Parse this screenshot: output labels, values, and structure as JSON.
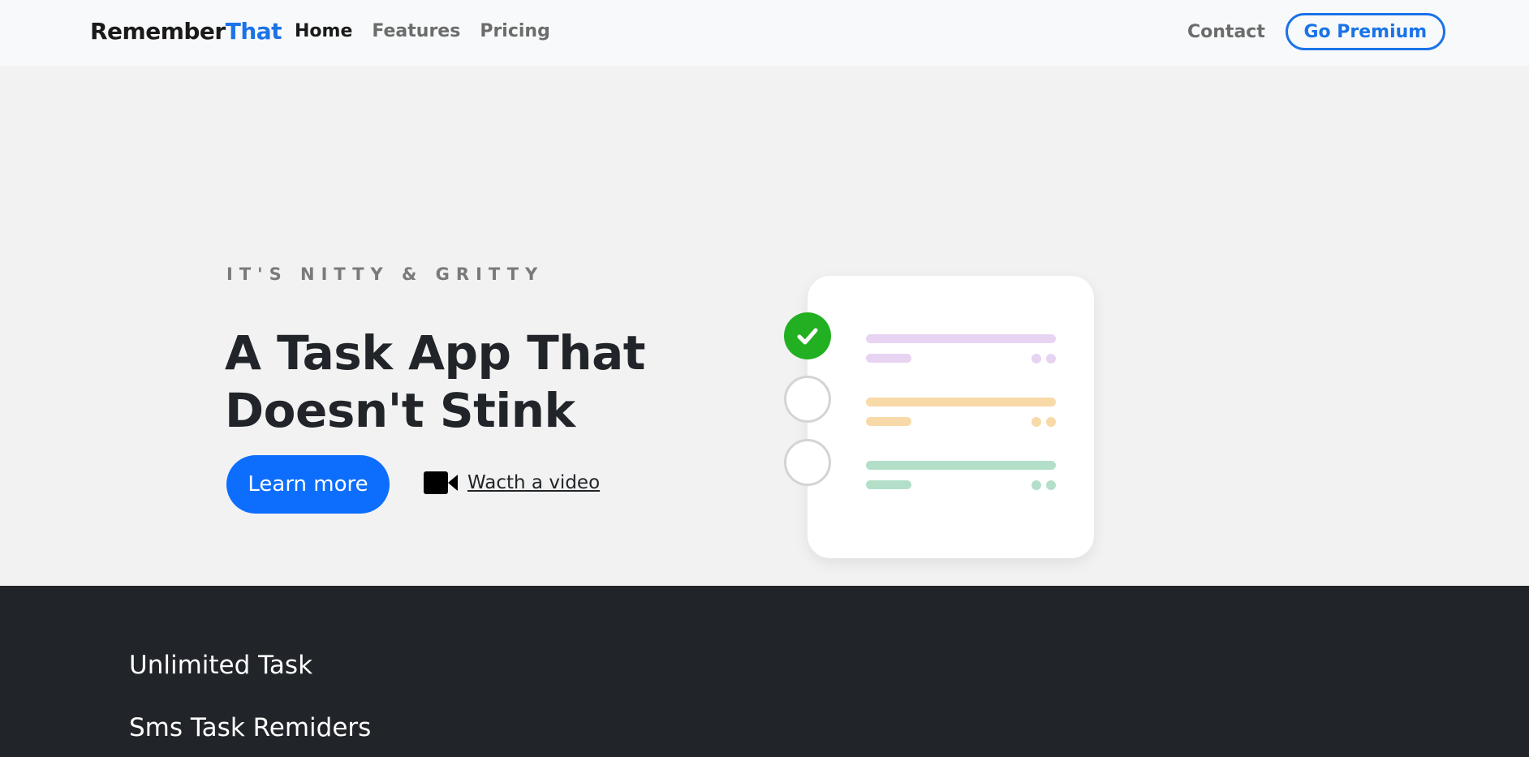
{
  "brand": {
    "part1": "Remember",
    "part2": "That"
  },
  "nav": {
    "links": [
      "Home",
      "Features",
      "Pricing"
    ],
    "contact": "Contact",
    "premium": "Go Premium"
  },
  "hero": {
    "eyebrow": "IT'S NITTY & GRITTY",
    "headline_line1": "A Task App That",
    "headline_line2": "Doesn't Stink",
    "cta": "Learn more",
    "video_link": "Wacth a video"
  },
  "illustration": {
    "tasks": [
      {
        "done": true,
        "color": "#e8d3f2"
      },
      {
        "done": false,
        "color": "#f8d9a8"
      },
      {
        "done": false,
        "color": "#b3dfc9"
      }
    ]
  },
  "features": {
    "items": [
      "Unlimited Task",
      "Sms Task Remiders"
    ]
  },
  "colors": {
    "accent": "#1a73e8",
    "button_primary": "#0d6efd",
    "dark_section": "#212529",
    "check_green": "#22b022"
  }
}
